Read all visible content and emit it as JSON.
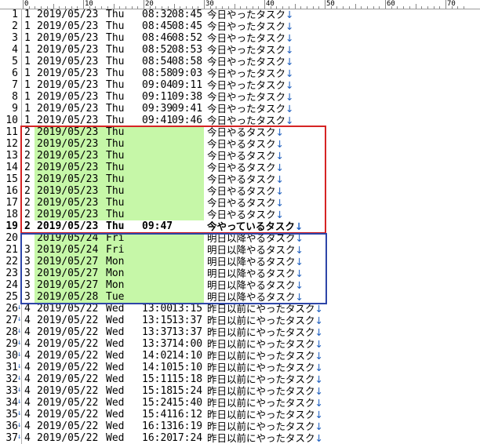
{
  "colors": {
    "highlight": "#c6f7a8",
    "red_box": "#d62424",
    "blue_box": "#2d45a8",
    "newline_mark": "#1f5fbf"
  },
  "ruler": {
    "labels": [
      "0",
      "10",
      "20",
      "30",
      "40",
      "50",
      "60",
      "70"
    ]
  },
  "rows": [
    {
      "n": "1",
      "mark": "",
      "g": "1",
      "d": "2019/05/23",
      "w": "Thu",
      "t1": "08:32",
      "t2": "08:45",
      "task": "今日やったタスク",
      "nl": "↓",
      "hl": false,
      "bold": false
    },
    {
      "n": "2",
      "mark": "",
      "g": "1",
      "d": "2019/05/23",
      "w": "Thu",
      "t1": "08:45",
      "t2": "08:45",
      "task": "今日やったタスク",
      "nl": "↓",
      "hl": false,
      "bold": false
    },
    {
      "n": "3",
      "mark": "",
      "g": "1",
      "d": "2019/05/23",
      "w": "Thu",
      "t1": "08:46",
      "t2": "08:52",
      "task": "今日やったタスク",
      "nl": "↓",
      "hl": false,
      "bold": false
    },
    {
      "n": "4",
      "mark": "",
      "g": "1",
      "d": "2019/05/23",
      "w": "Thu",
      "t1": "08:52",
      "t2": "08:53",
      "task": "今日やったタスク",
      "nl": "↓",
      "hl": false,
      "bold": false
    },
    {
      "n": "5",
      "mark": "",
      "g": "1",
      "d": "2019/05/23",
      "w": "Thu",
      "t1": "08:54",
      "t2": "08:58",
      "task": "今日やったタスク",
      "nl": "↓",
      "hl": false,
      "bold": false
    },
    {
      "n": "6",
      "mark": "",
      "g": "1",
      "d": "2019/05/23",
      "w": "Thu",
      "t1": "08:58",
      "t2": "09:03",
      "task": "今日やったタスク",
      "nl": "↓",
      "hl": false,
      "bold": false
    },
    {
      "n": "7",
      "mark": "",
      "g": "1",
      "d": "2019/05/23",
      "w": "Thu",
      "t1": "09:04",
      "t2": "09:11",
      "task": "今日やったタスク",
      "nl": "↓",
      "hl": false,
      "bold": false
    },
    {
      "n": "8",
      "mark": "",
      "g": "1",
      "d": "2019/05/23",
      "w": "Thu",
      "t1": "09:11",
      "t2": "09:38",
      "task": "今日やったタスク",
      "nl": "↓",
      "hl": false,
      "bold": false
    },
    {
      "n": "9",
      "mark": "",
      "g": "1",
      "d": "2019/05/23",
      "w": "Thu",
      "t1": "09:39",
      "t2": "09:41",
      "task": "今日やったタスク",
      "nl": "↓",
      "hl": false,
      "bold": false
    },
    {
      "n": "10",
      "mark": "",
      "g": "1",
      "d": "2019/05/23",
      "w": "Thu",
      "t1": "09:41",
      "t2": "09:46",
      "task": "今日やったタスク",
      "nl": "↓",
      "hl": false,
      "bold": false
    },
    {
      "n": "11",
      "mark": "",
      "g": "2",
      "d": "2019/05/23",
      "w": "Thu",
      "t1": "",
      "t2": "",
      "task": "今日やるタスク",
      "nl": "↓",
      "hl": true,
      "bold": false
    },
    {
      "n": "12",
      "mark": "",
      "g": "2",
      "d": "2019/05/23",
      "w": "Thu",
      "t1": "",
      "t2": "",
      "task": "今日やるタスク",
      "nl": "↓",
      "hl": true,
      "bold": false
    },
    {
      "n": "13",
      "mark": "",
      "g": "2",
      "d": "2019/05/23",
      "w": "Thu",
      "t1": "",
      "t2": "",
      "task": "今日やるタスク",
      "nl": "↓",
      "hl": true,
      "bold": false
    },
    {
      "n": "14",
      "mark": "",
      "g": "2",
      "d": "2019/05/23",
      "w": "Thu",
      "t1": "",
      "t2": "",
      "task": "今日やるタスク",
      "nl": "↓",
      "hl": true,
      "bold": false
    },
    {
      "n": "15",
      "mark": "",
      "g": "2",
      "d": "2019/05/23",
      "w": "Thu",
      "t1": "",
      "t2": "",
      "task": "今日やるタスク",
      "nl": "↓",
      "hl": true,
      "bold": false
    },
    {
      "n": "16",
      "mark": "",
      "g": "2",
      "d": "2019/05/23",
      "w": "Thu",
      "t1": "",
      "t2": "",
      "task": "今日やるタスク",
      "nl": "↓",
      "hl": true,
      "bold": false
    },
    {
      "n": "17",
      "mark": "",
      "g": "2",
      "d": "2019/05/23",
      "w": "Thu",
      "t1": "",
      "t2": "",
      "task": "今日やるタスク",
      "nl": "↓",
      "hl": true,
      "bold": false
    },
    {
      "n": "18",
      "mark": "",
      "g": "2",
      "d": "2019/05/23",
      "w": "Thu",
      "t1": "",
      "t2": "",
      "task": "今日やるタスク",
      "nl": "↓",
      "hl": true,
      "bold": false
    },
    {
      "n": "19",
      "mark": "",
      "g": "2",
      "d": "2019/05/23",
      "w": "Thu",
      "t1": "09:47",
      "t2": "",
      "task": "今やっているタスク",
      "nl": "↓",
      "hl": false,
      "bold": true
    },
    {
      "n": "20",
      "mark": "",
      "g": "",
      "d": "2019/05/24",
      "w": "Fri",
      "t1": "",
      "t2": "",
      "task": "明日以降やるタスク",
      "nl": "↓",
      "hl": true,
      "bold": false
    },
    {
      "n": "21",
      "mark": "",
      "g": "3",
      "d": "2019/05/24",
      "w": "Fri",
      "t1": "",
      "t2": "",
      "task": "明日以降やるタスク",
      "nl": "↓",
      "hl": true,
      "bold": false
    },
    {
      "n": "22",
      "mark": "",
      "g": "3",
      "d": "2019/05/27",
      "w": "Mon",
      "t1": "",
      "t2": "",
      "task": "明日以降やるタスク",
      "nl": "↓",
      "hl": true,
      "bold": false
    },
    {
      "n": "23",
      "mark": "",
      "g": "3",
      "d": "2019/05/27",
      "w": "Mon",
      "t1": "",
      "t2": "",
      "task": "明日以降やるタスク",
      "nl": "↓",
      "hl": true,
      "bold": false
    },
    {
      "n": "24",
      "mark": "",
      "g": "3",
      "d": "2019/05/27",
      "w": "Mon",
      "t1": "",
      "t2": "",
      "task": "明日以降やるタスク",
      "nl": "↓",
      "hl": true,
      "bold": false
    },
    {
      "n": "25",
      "mark": "",
      "g": "3",
      "d": "2019/05/28",
      "w": "Tue",
      "t1": "",
      "t2": "",
      "task": "明日以降やるタスク",
      "nl": "↓",
      "hl": true,
      "bold": false
    },
    {
      "n": "26",
      "mark": "↓",
      "g": "4",
      "d": "2019/05/22",
      "w": "Wed",
      "t1": "13:00",
      "t2": "13:15",
      "task": "昨日以前にやったタスク",
      "nl": "↓",
      "hl": false,
      "bold": false
    },
    {
      "n": "27",
      "mark": "↓",
      "g": "4",
      "d": "2019/05/22",
      "w": "Wed",
      "t1": "13:15",
      "t2": "13:37",
      "task": "昨日以前にやったタスク",
      "nl": "↓",
      "hl": false,
      "bold": false
    },
    {
      "n": "28",
      "mark": "↓",
      "g": "4",
      "d": "2019/05/22",
      "w": "Wed",
      "t1": "13:37",
      "t2": "13:37",
      "task": "昨日以前にやったタスク",
      "nl": "↓",
      "hl": false,
      "bold": false
    },
    {
      "n": "29",
      "mark": "↓",
      "g": "4",
      "d": "2019/05/22",
      "w": "Wed",
      "t1": "13:37",
      "t2": "14:00",
      "task": "昨日以前にやったタスク",
      "nl": "↓",
      "hl": false,
      "bold": false
    },
    {
      "n": "30",
      "mark": "↓",
      "g": "4",
      "d": "2019/05/22",
      "w": "Wed",
      "t1": "14:02",
      "t2": "14:10",
      "task": "昨日以前にやったタスク",
      "nl": "↓",
      "hl": false,
      "bold": false
    },
    {
      "n": "31",
      "mark": "↓",
      "g": "4",
      "d": "2019/05/22",
      "w": "Wed",
      "t1": "14:10",
      "t2": "15:10",
      "task": "昨日以前にやったタスク",
      "nl": "↓",
      "hl": false,
      "bold": false
    },
    {
      "n": "32",
      "mark": "↓",
      "g": "4",
      "d": "2019/05/22",
      "w": "Wed",
      "t1": "15:11",
      "t2": "15:18",
      "task": "昨日以前にやったタスク",
      "nl": "↓",
      "hl": false,
      "bold": false
    },
    {
      "n": "33",
      "mark": "↓",
      "g": "4",
      "d": "2019/05/22",
      "w": "Wed",
      "t1": "15:18",
      "t2": "15:24",
      "task": "昨日以前にやったタスク",
      "nl": "↓",
      "hl": false,
      "bold": false
    },
    {
      "n": "34",
      "mark": "↓",
      "g": "4",
      "d": "2019/05/22",
      "w": "Wed",
      "t1": "15:24",
      "t2": "15:40",
      "task": "昨日以前にやったタスク",
      "nl": "↓",
      "hl": false,
      "bold": false
    },
    {
      "n": "35",
      "mark": "↓",
      "g": "4",
      "d": "2019/05/22",
      "w": "Wed",
      "t1": "15:41",
      "t2": "16:12",
      "task": "昨日以前にやったタスク",
      "nl": "↓",
      "hl": false,
      "bold": false
    },
    {
      "n": "36",
      "mark": "↓",
      "g": "4",
      "d": "2019/05/22",
      "w": "Wed",
      "t1": "16:13",
      "t2": "16:19",
      "task": "昨日以前にやったタスク",
      "nl": "↓",
      "hl": false,
      "bold": false
    },
    {
      "n": "37",
      "mark": "↓",
      "g": "4",
      "d": "2019/05/22",
      "w": "Wed",
      "t1": "16:20",
      "t2": "17:24",
      "task": "昨日以前にやったタスク",
      "nl": "↓",
      "hl": false,
      "bold": false
    }
  ]
}
